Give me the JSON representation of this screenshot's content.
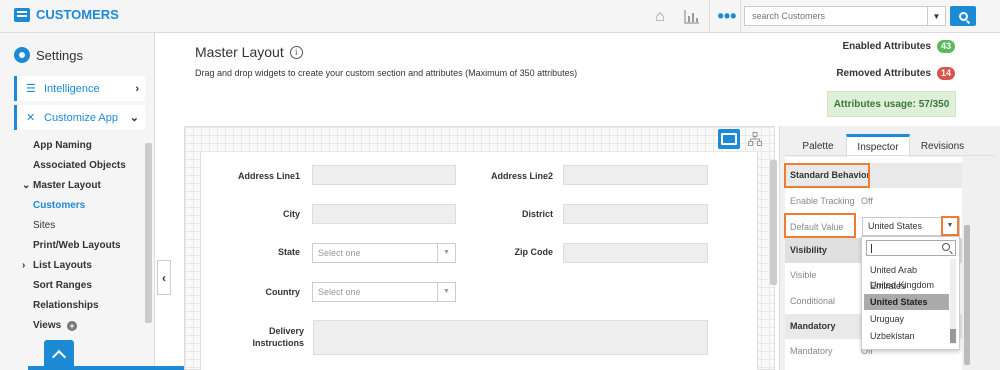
{
  "app": {
    "title": "CUSTOMERS"
  },
  "topbar": {
    "icons": [
      "home-icon",
      "chart-icon",
      "more-dots-icon",
      "search-icon"
    ],
    "search_placeholder": "search Customers"
  },
  "sidebar": {
    "title": "Settings",
    "sections": [
      {
        "label": "Intelligence",
        "expanded": false
      },
      {
        "label": "Customize App",
        "expanded": true
      }
    ],
    "items": [
      {
        "label": "App Naming"
      },
      {
        "label": "Associated Objects"
      },
      {
        "label": "Master Layout",
        "expanded": true
      },
      {
        "label": "Customers",
        "active": true
      },
      {
        "label": "Sites"
      },
      {
        "label": "Print/Web Layouts"
      },
      {
        "label": "List Layouts",
        "collapsed": true
      },
      {
        "label": "Sort Ranges"
      },
      {
        "label": "Relationships"
      },
      {
        "label": "Views"
      }
    ]
  },
  "main": {
    "title": "Master Layout",
    "subtitle": "Drag and drop widgets to create your custom section and attributes (Maximum of 350 attributes)",
    "enabled_label": "Enabled Attributes",
    "enabled_count": "43",
    "removed_label": "Removed Attributes",
    "removed_count": "14",
    "usage": "Attributes usage: 57/350",
    "colors": {
      "accent": "#1d8ad6",
      "enabled": "#5cb85c",
      "removed": "#d9534f",
      "highlight": "#ee7d31"
    }
  },
  "form": {
    "address1": "Address Line1",
    "address2": "Address Line2",
    "city": "City",
    "district": "District",
    "state": "State",
    "state_placeholder": "Select one",
    "zip": "Zip Code",
    "country": "Country",
    "country_placeholder": "Select one",
    "delivery": "Delivery Instructions"
  },
  "panel": {
    "tabs": [
      {
        "label": "Palette"
      },
      {
        "label": "Inspector",
        "active": true
      },
      {
        "label": "Revisions"
      }
    ],
    "standard_behavior": "Standard Behavior",
    "enable_tracking_label": "Enable Tracking",
    "enable_tracking_value": "Off",
    "default_value_label": "Default Value",
    "default_value": "United States",
    "visibility": "Visibility",
    "visible_label": "Visible",
    "conditional_label": "Conditional",
    "mandatory": "Mandatory",
    "mandatory_label": "Mandatory",
    "mandatory_value": "Off",
    "dropdown_options": [
      {
        "label": "United Arab Emirates"
      },
      {
        "label": "United Kingdom"
      },
      {
        "label": "United States",
        "selected": true
      },
      {
        "label": "Uruguay"
      },
      {
        "label": "Uzbekistan"
      }
    ]
  }
}
